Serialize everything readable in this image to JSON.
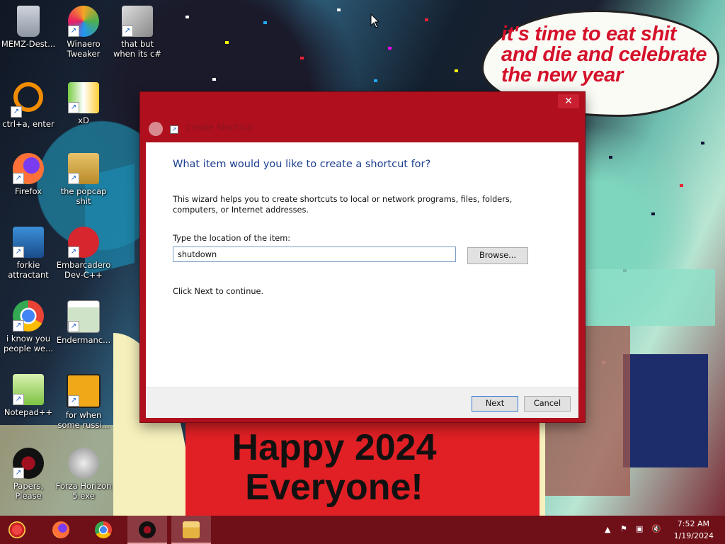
{
  "desktop_icons": [
    {
      "label": "MEMZ-Dest...",
      "icon": "memz-trash-icon"
    },
    {
      "label": "Winaero Tweaker",
      "icon": "winaero-icon"
    },
    {
      "label": "that but when its c#",
      "icon": "stacked-windows-icon"
    },
    {
      "label": "ctrl+a, enter",
      "icon": "orange-ring-icon"
    },
    {
      "label": "xD",
      "icon": "hxd-icon"
    },
    {
      "label": "Firefox",
      "icon": "firefox-icon"
    },
    {
      "label": "the popcap shit",
      "icon": "popcap-folder-icon"
    },
    {
      "label": "forkie attractant",
      "icon": "gear-monitor-icon"
    },
    {
      "label": "Embarcadero Dev-C++",
      "icon": "devcpp-icon"
    },
    {
      "label": "i know you people we...",
      "icon": "chrome-icon"
    },
    {
      "label": "Endermanc...",
      "icon": "window-app-icon"
    },
    {
      "label": "Notepad++",
      "icon": "notepadpp-icon"
    },
    {
      "label": "for when some russi...",
      "icon": "de-app-icon"
    },
    {
      "label": "Papers, Please",
      "icon": "papers-please-icon"
    },
    {
      "label": "Forza Horizon 5.exe",
      "icon": "flash-icon"
    }
  ],
  "wallpaper": {
    "speech_bubble": "it's time to eat shit and die and celebrate the new year",
    "banner_line1": "Happy 2024",
    "banner_line2": "Everyone!"
  },
  "dialog": {
    "title": "Create Shortcut",
    "heading": "What item would you like to create a shortcut for?",
    "description": "This wizard helps you to create shortcuts to local or network programs, files, folders, computers, or Internet addresses.",
    "location_label": "Type the location of the item:",
    "location_value": "shutdown",
    "browse_label": "Browse...",
    "continue_text": "Click Next to continue.",
    "next_label": "Next",
    "cancel_label": "Cancel",
    "close_glyph": "✕"
  },
  "taskbar": {
    "items": [
      {
        "icon": "start-button-icon"
      },
      {
        "icon": "firefox-icon"
      },
      {
        "icon": "chrome-icon"
      },
      {
        "icon": "papers-please-icon",
        "active": true
      },
      {
        "icon": "file-explorer-icon",
        "active": true
      }
    ],
    "time": "7:52 AM",
    "date": "1/19/2024"
  },
  "colors": {
    "dialog_frame": "#b00f1e",
    "taskbar": "#6f0f17",
    "heading": "#1a3d8f"
  }
}
